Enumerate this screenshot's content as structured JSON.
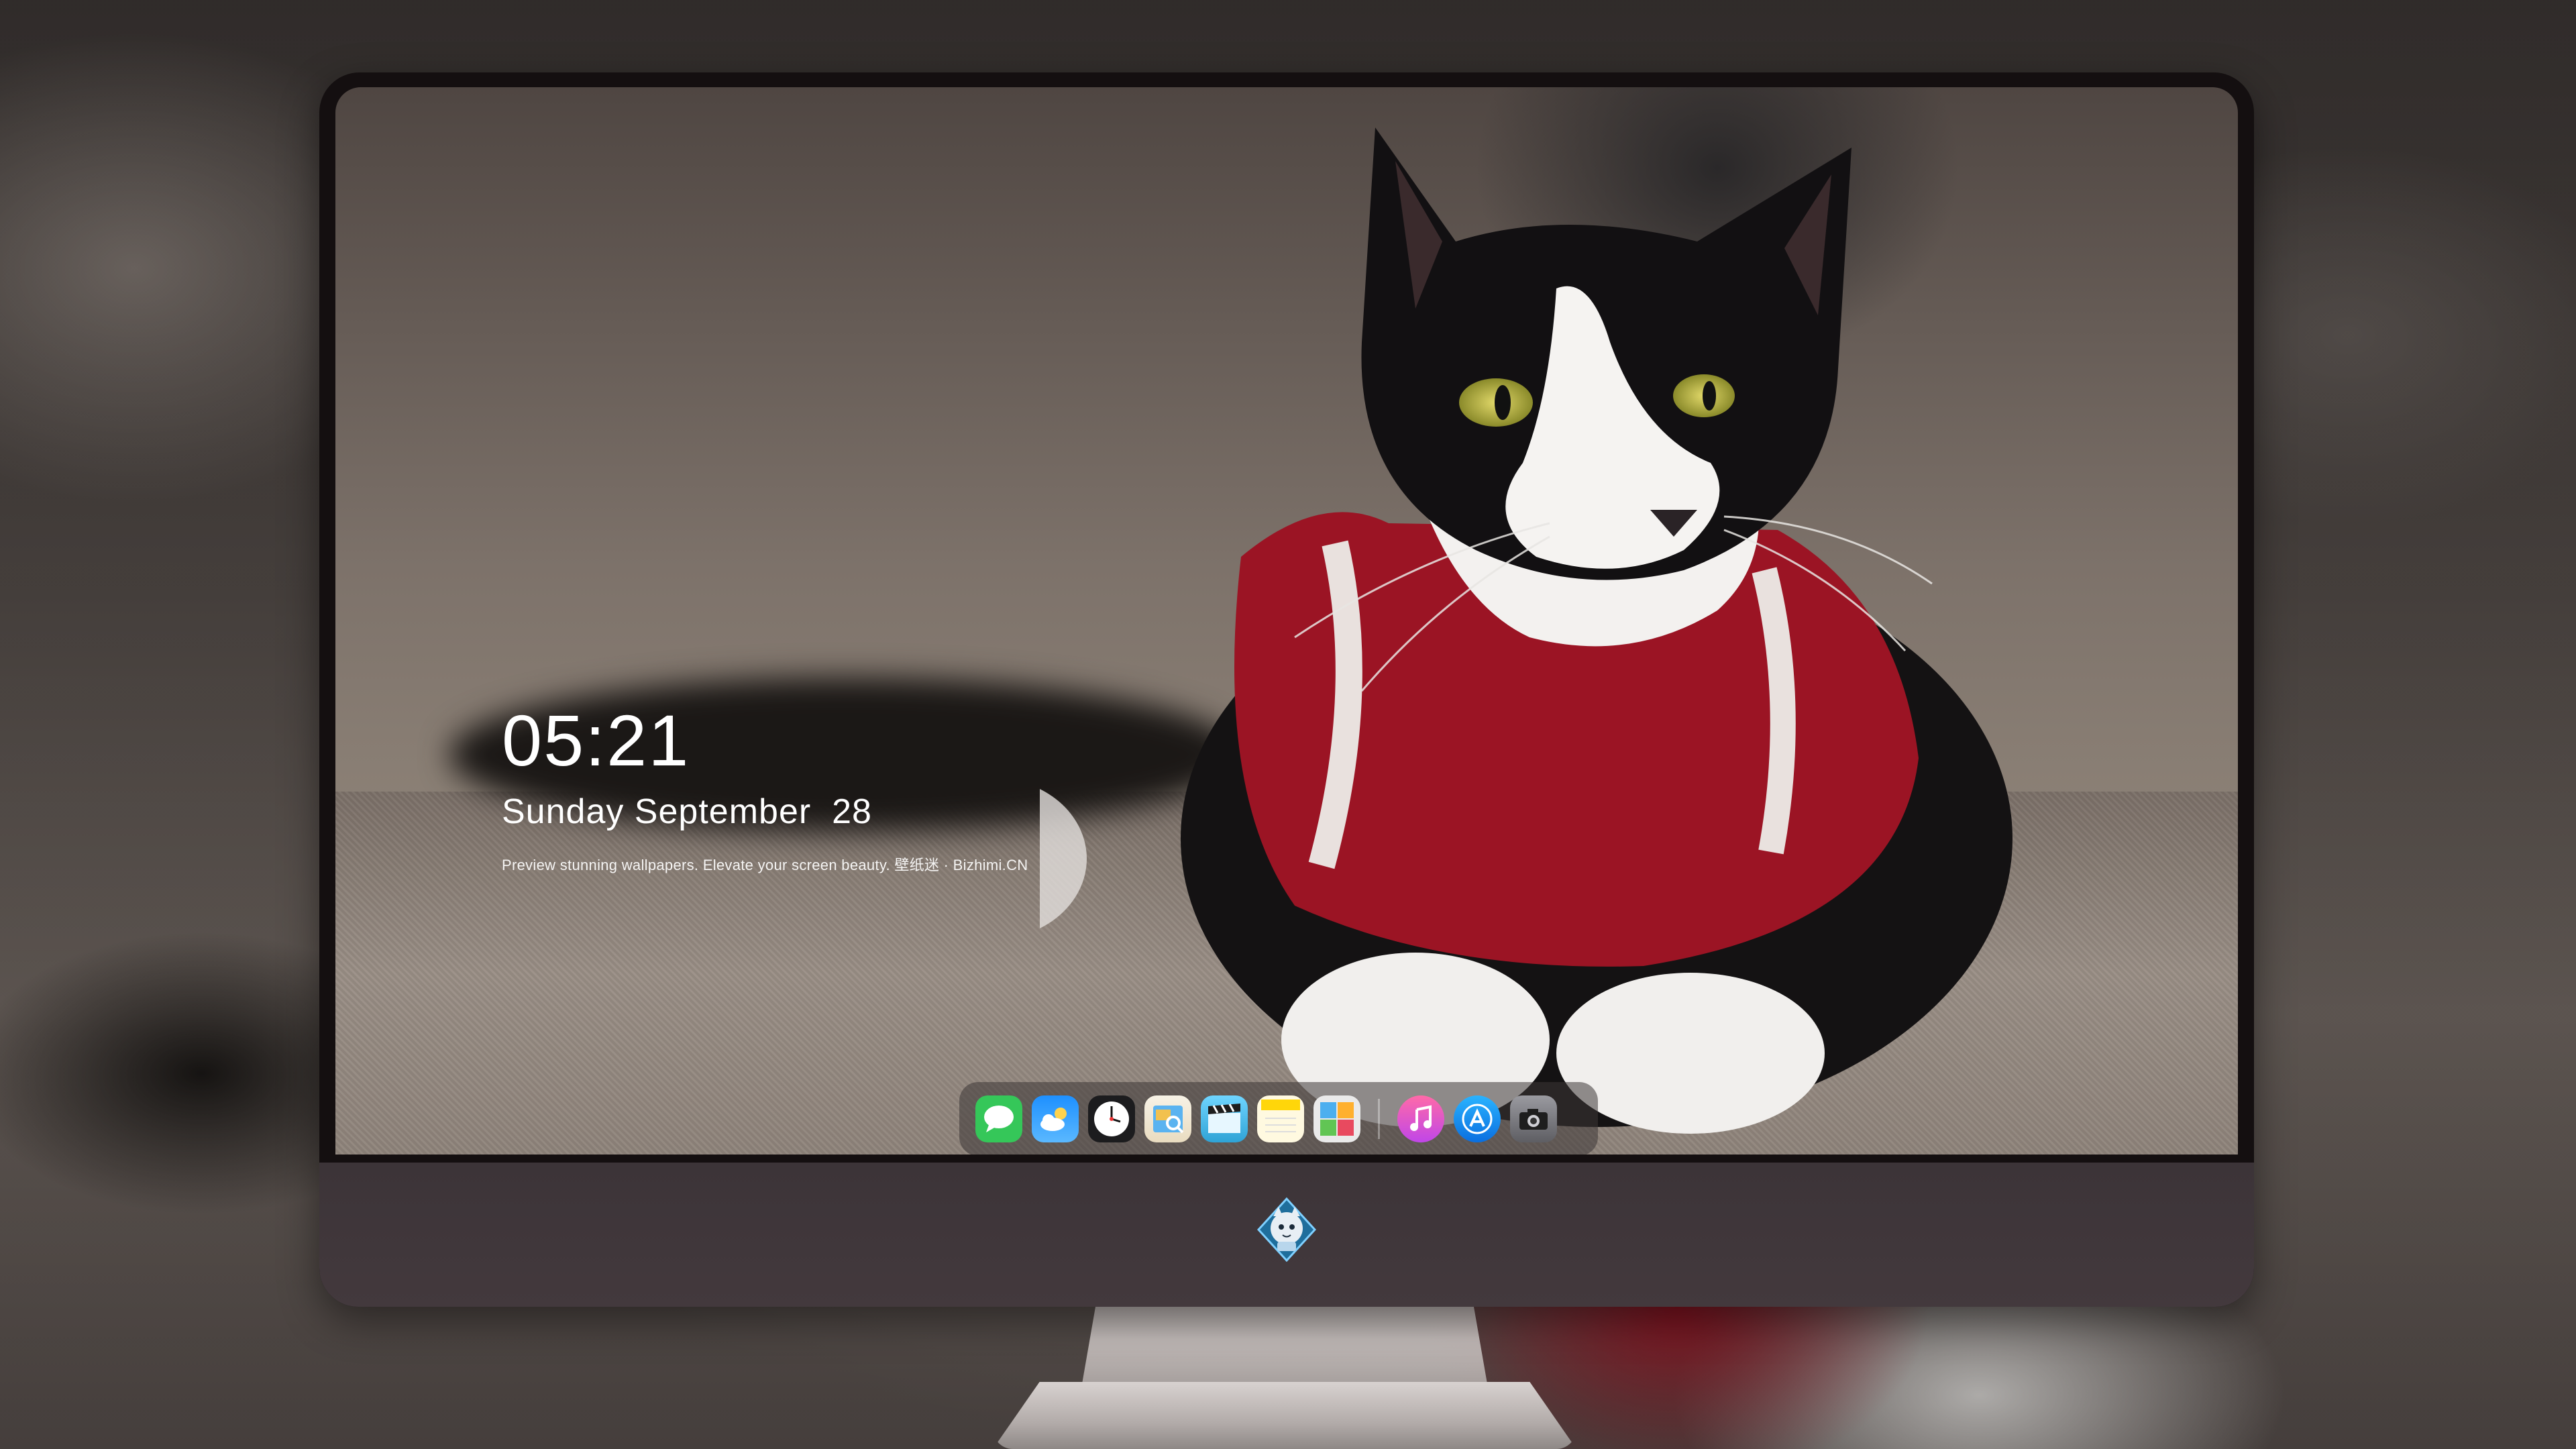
{
  "lock_screen": {
    "time": "05:21",
    "date": "Sunday September  28",
    "tagline": "Preview stunning wallpapers. Elevate your screen beauty. 壁纸迷 · Bizhimi.CN"
  },
  "dock": {
    "apps": [
      {
        "name": "messages-icon",
        "color": "#35c759"
      },
      {
        "name": "weather-icon",
        "color": "#1e90ff"
      },
      {
        "name": "clock-icon",
        "color": "#1c1c1e"
      },
      {
        "name": "preview-icon",
        "color": "#f2c14e"
      },
      {
        "name": "final-cut-icon",
        "color": "#5ac8fa"
      },
      {
        "name": "notes-icon",
        "color": "#ffd60a"
      },
      {
        "name": "photo-booth-icon",
        "color": "#e8e8e8"
      },
      {
        "name": "music-icon",
        "color": "#fc3c8d"
      },
      {
        "name": "app-store-icon",
        "color": "#0a84ff"
      },
      {
        "name": "camera-icon",
        "color": "#8e8e93"
      }
    ]
  },
  "monitor": {
    "logo": "mascot-logo"
  }
}
